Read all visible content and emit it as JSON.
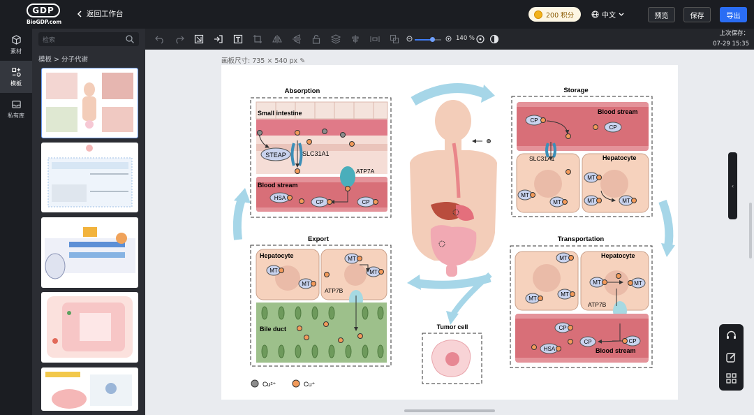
{
  "header": {
    "logo_text": "GDP",
    "domain": "BioGDP.com",
    "back_label": "返回工作台",
    "credits": "200 积分",
    "language": "中文",
    "preview_label": "预览",
    "save_label": "保存",
    "export_label": "导出"
  },
  "leftnav": {
    "items": [
      {
        "label": "素材",
        "icon": "cube-icon"
      },
      {
        "label": "模板",
        "icon": "template-icon"
      },
      {
        "label": "私有库",
        "icon": "inbox-icon"
      }
    ]
  },
  "panel": {
    "search_placeholder": "检索",
    "breadcrumb": "模板 > 分子代谢"
  },
  "toolbar": {
    "zoom": "140 %",
    "last_save_label": "上次保存：",
    "last_save_time": "07-29 15:35"
  },
  "canvas": {
    "board_size": "画板尺寸: 735 × 540 px"
  },
  "figure": {
    "absorption": "Absorption",
    "small_intestine": "Small intestine",
    "steap": "STEAP",
    "slc31a1": "SLC31A1",
    "atp7a": "ATP7A",
    "blood_stream": "Blood stream",
    "hsa": "HSA",
    "cp": "CP",
    "storage": "Storage",
    "hepatocyte": "Hepatocyte",
    "mt": "MT",
    "transportation": "Transportation",
    "atp7b": "ATP7B",
    "export": "Export",
    "bile_duct": "Bile duct",
    "tumor_cell": "Tumor cell",
    "cu2": "Cu²⁺",
    "cu1": "Cu⁺"
  },
  "colors": {
    "accent": "#2a6df4",
    "cu2": "#8c8c8c",
    "cu1": "#f29a5a",
    "blood": "#d9737c",
    "hepatocyte": "#f6d2bd",
    "bile": "#9dc08b",
    "arrow": "#a6d6e8",
    "transporter": "#4aaebb",
    "protein": "#c9d3ee"
  }
}
